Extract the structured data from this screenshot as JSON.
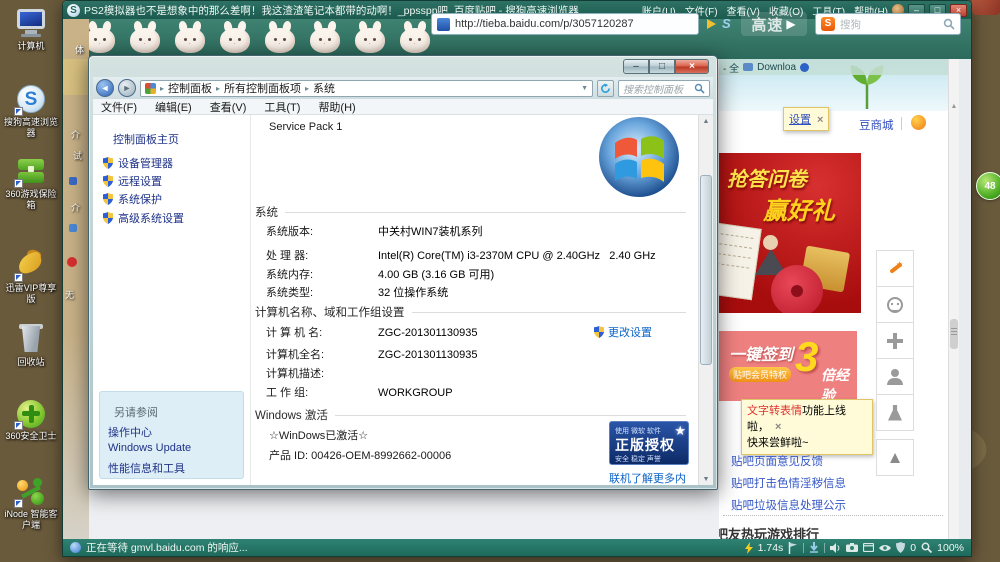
{
  "desktop": {
    "icons": [
      "计算机",
      "搜狗高速浏览器",
      "360游戏保险箱",
      "迅雷VIP尊享版",
      "回收站",
      "360安全卫士",
      "iNode 智能客户端"
    ],
    "partial_labels": [
      "体",
      "介",
      "试",
      "介",
      "无"
    ],
    "ball_value": "48"
  },
  "browser": {
    "title": "PS2模拟器也不是想象中的那么差啊！我这渣渣笔记本都带的动啊！_ppsspp吧_百度贴吧 - 搜狗高速浏览器",
    "menu": [
      "账户(U)",
      "文件(F)",
      "查看(V)",
      "收藏(O)",
      "工具(T)",
      "帮助(H)"
    ],
    "address_url": "http://tieba.baidu.com/p/3057120287",
    "speed_label": "高速",
    "search_placeholder": "搜狗",
    "bookmarks": [
      "- 全",
      "Downloa"
    ],
    "status": {
      "loading": "正在等待 gmvl.baidu.com 的响应...",
      "speed": "1.74s",
      "shield_count": "0",
      "zoom": "100%"
    }
  },
  "control_panel": {
    "breadcrumb": [
      "控制面板",
      "所有控制面板项",
      "系统"
    ],
    "search_placeholder": "搜索控制面板",
    "menu": [
      "文件(F)",
      "编辑(E)",
      "查看(V)",
      "工具(T)",
      "帮助(H)"
    ],
    "sidebar": {
      "home": "控制面板主页",
      "links": [
        "设备管理器",
        "远程设置",
        "系统保护",
        "高级系统设置"
      ],
      "see_also": "另请参阅",
      "see_links": [
        "操作中心",
        "Windows Update",
        "性能信息和工具"
      ]
    },
    "main": {
      "service_pack": "Service Pack 1",
      "system": {
        "title": "系统",
        "rows": [
          {
            "label": "系统版本:",
            "value": "中关村WIN7装机系列"
          },
          {
            "label": "处 理 器:",
            "value": "Intel(R) Core(TM) i3-2370M CPU @ 2.40GHz   2.40 GHz"
          },
          {
            "label": "系统内存:",
            "value": "4.00 GB (3.16 GB 可用)"
          },
          {
            "label": "系统类型:",
            "value": "32 位操作系统"
          }
        ]
      },
      "computer_name": {
        "title": "计算机名称、域和工作组设置",
        "rows": [
          {
            "label": "计 算 机 名:",
            "value": "ZGC-201301130935"
          },
          {
            "label": "计算机全名:",
            "value": "ZGC-201301130935"
          },
          {
            "label": "计算机描述:",
            "value": ""
          },
          {
            "label": "工 作 组:",
            "value": "WORKGROUP"
          }
        ],
        "change_link": "更改设置"
      },
      "activation": {
        "title": "Windows 激活",
        "status": "☆WinDows已激活☆",
        "product_id": "产品 ID: 00426-OEM-8992662-00006",
        "badge": {
          "line1": "使用 微软 软件",
          "line2": "正版授权",
          "line3": "安全 稳定 声誉"
        },
        "more_link": "联机了解更多内容..."
      }
    }
  },
  "tieba": {
    "settings_tooltip": "设置",
    "mall_link": "豆商城",
    "banner_survey": {
      "line1": "抢答问卷",
      "line2": "赢好礼"
    },
    "banner_sign": {
      "label": "一键签到",
      "badge": "贴吧会员特权",
      "big": "3",
      "suffix": "倍经验"
    },
    "feature_tip": {
      "highlight": "文字转表情",
      "rest": "功能上线啦，",
      "line2": "快来尝鲜啦~"
    },
    "links": [
      "贴吧页面意见反馈",
      "贴吧打击色情淫秽信息",
      "贴吧垃圾信息处理公示"
    ],
    "footer_heading": "吧友热玩游戏排行"
  },
  "icons": {
    "close": "×",
    "minimize": "–",
    "maximize": "□",
    "back": "◄",
    "forward": "►",
    "sep": "▸",
    "dropdown": "▼",
    "play": "▶",
    "up_arrow": "▲",
    "star": "★",
    "sogou_s": "S"
  }
}
